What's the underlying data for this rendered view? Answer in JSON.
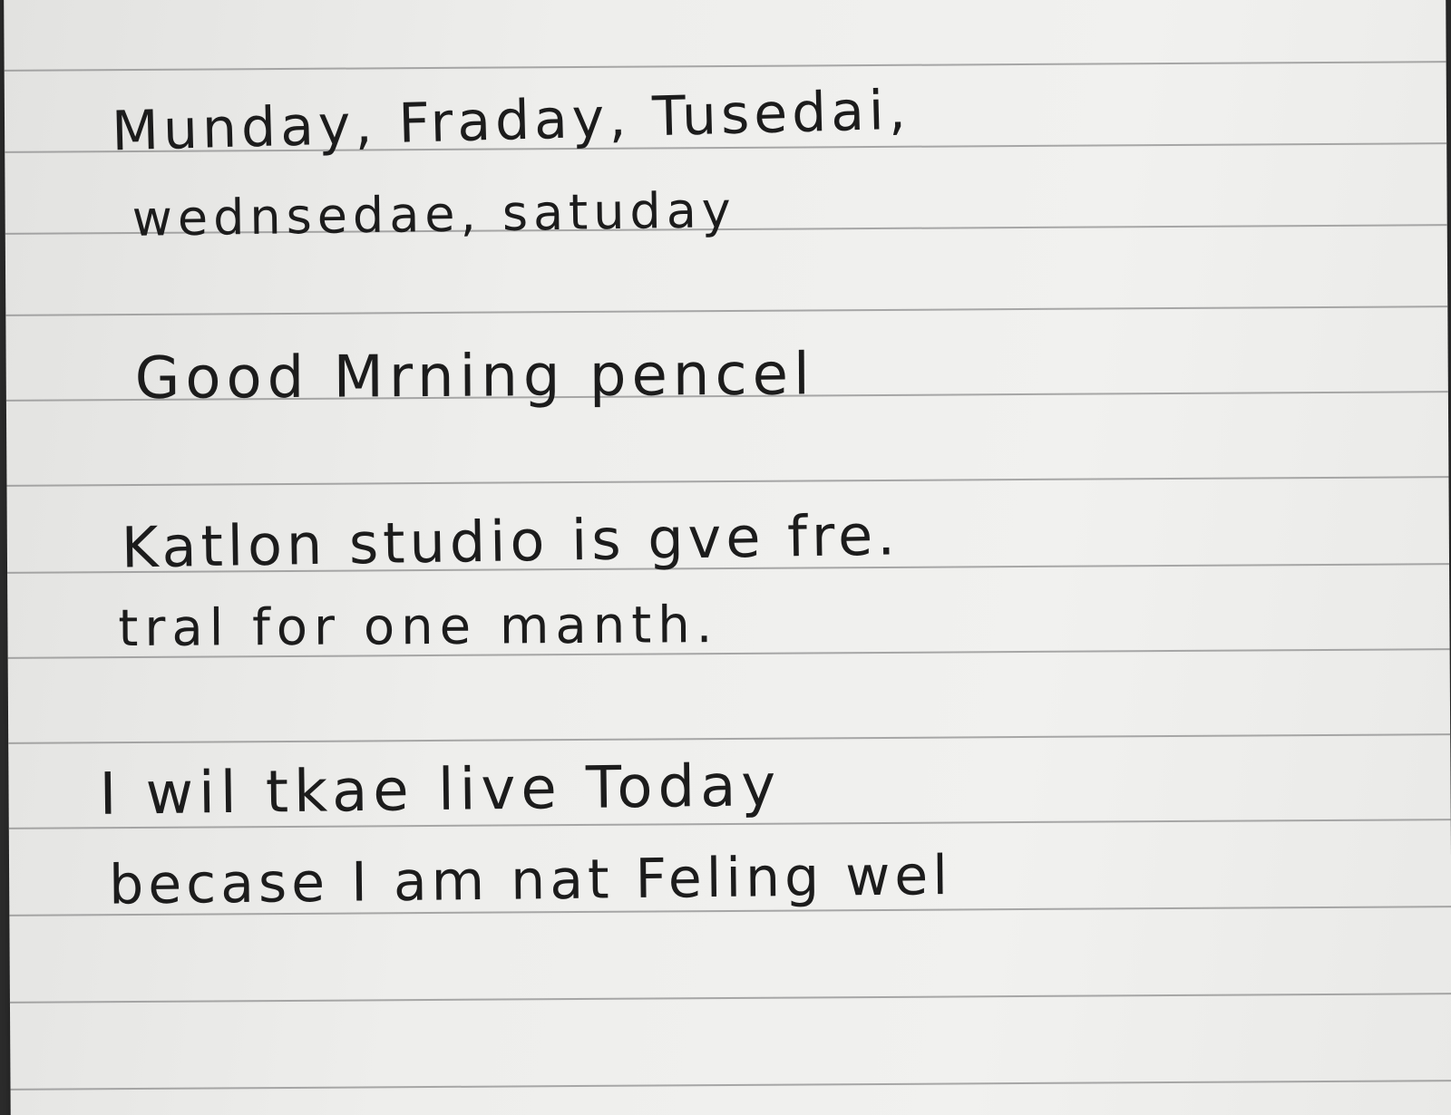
{
  "note": {
    "lines": [
      "Munday, Fraday, Tusedai,",
      "wednsedae, satuday",
      "Good Mrning pencel",
      "Katlon studio is gve fre.",
      "tral for one manth.",
      "I wil tkae live Today",
      "becase I am nat Feling wel"
    ]
  }
}
